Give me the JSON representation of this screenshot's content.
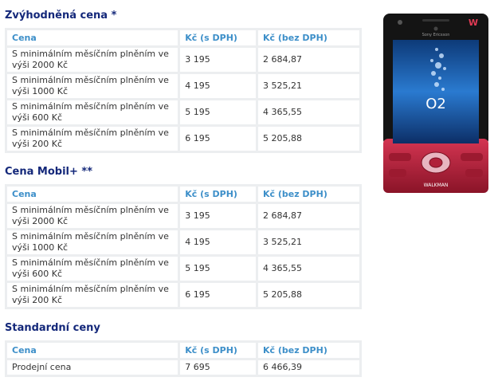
{
  "sections": [
    {
      "title": "Zvýhodněná cena *",
      "headers": [
        "Cena",
        "Kč (s DPH)",
        "Kč (bez DPH)"
      ],
      "rows": [
        {
          "label": "S minimálním měsíčním plněním ve výši 2000 Kč",
          "with_vat": "3 195",
          "without_vat": "2 684,87"
        },
        {
          "label": "S minimálním měsíčním plněním ve výši 1000 Kč",
          "with_vat": "4 195",
          "without_vat": "3 525,21"
        },
        {
          "label": "S minimálním měsíčním plněním ve výši 600 Kč",
          "with_vat": "5 195",
          "without_vat": "4 365,55"
        },
        {
          "label": "S minimálním měsíčním plněním ve výši 200 Kč",
          "with_vat": "6 195",
          "without_vat": "5 205,88"
        }
      ]
    },
    {
      "title": "Cena Mobil+ **",
      "headers": [
        "Cena",
        "Kč (s DPH)",
        "Kč (bez DPH)"
      ],
      "rows": [
        {
          "label": "S minimálním měsíčním plněním ve výši 2000 Kč",
          "with_vat": "3 195",
          "without_vat": "2 684,87"
        },
        {
          "label": "S minimálním měsíčním plněním ve výši 1000 Kč",
          "with_vat": "4 195",
          "without_vat": "3 525,21"
        },
        {
          "label": "S minimálním měsíčním plněním ve výši 600 Kč",
          "with_vat": "5 195",
          "without_vat": "4 365,55"
        },
        {
          "label": "S minimálním měsíčním plněním ve výši 200 Kč",
          "with_vat": "6 195",
          "without_vat": "5 205,88"
        }
      ]
    },
    {
      "title": "Standardní ceny",
      "headers": [
        "Cena",
        "Kč (s DPH)",
        "Kč (bez DPH)"
      ],
      "rows": [
        {
          "label": "Prodejní cena",
          "with_vat": "7 695",
          "without_vat": "6 466,39"
        }
      ]
    }
  ],
  "phone": {
    "brand": "Sony Ericsson",
    "operator_logo": "O2",
    "walkman_label": "WALKMAN",
    "body_color": "#b0213a",
    "screen_color": "#1a5fa8"
  }
}
